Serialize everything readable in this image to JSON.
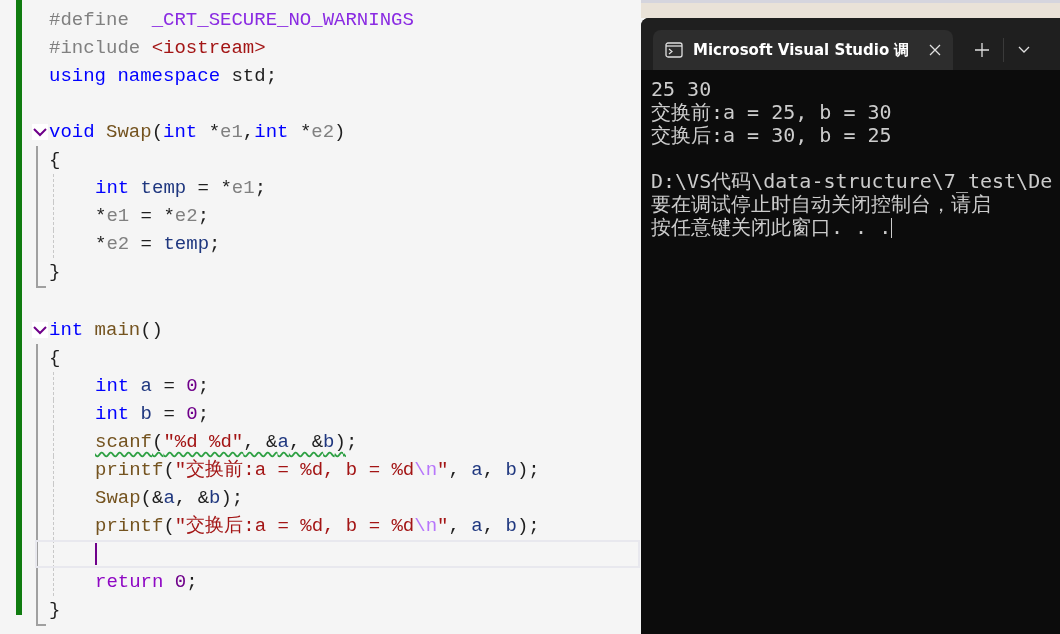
{
  "editor": {
    "blocks": [
      {
        "kind": "plain",
        "lines": [
          {
            "kind": "code",
            "tokens": [
              {
                "t": "#define  ",
                "kind": "pre"
              },
              {
                "t": "_CRT_SECURE_NO_WARNINGS",
                "kind": "macro"
              }
            ]
          },
          {
            "kind": "code",
            "tokens": [
              {
                "t": "#include ",
                "kind": "pre"
              },
              {
                "t": "<iostream>",
                "kind": "str"
              }
            ]
          },
          {
            "kind": "code",
            "tokens": [
              {
                "t": "using namespace",
                "kind": "kw"
              },
              {
                "t": " std;",
                "kind": "plain"
              }
            ]
          },
          {
            "kind": "blank",
            "current": false
          }
        ]
      },
      {
        "kind": "function",
        "expanded": true,
        "header": [
          {
            "t": "void ",
            "kind": "kw"
          },
          {
            "t": "Swap",
            "kind": "fn"
          },
          {
            "t": "(",
            "kind": "plain"
          },
          {
            "t": "int ",
            "kind": "kw"
          },
          {
            "t": "*",
            "kind": "plain"
          },
          {
            "t": "e1",
            "kind": "param"
          },
          {
            "t": ",",
            "kind": "plain"
          },
          {
            "t": "int ",
            "kind": "kw"
          },
          {
            "t": "*",
            "kind": "plain"
          },
          {
            "t": "e2",
            "kind": "param"
          },
          {
            "t": ")",
            "kind": "plain"
          }
        ],
        "lines": [
          {
            "kind": "code",
            "indented": false,
            "tokens": [
              {
                "t": "{",
                "kind": "plain"
              }
            ]
          },
          {
            "kind": "code",
            "indented": true,
            "tokens": [
              {
                "t": "int ",
                "kind": "kw"
              },
              {
                "t": "temp",
                "kind": "var"
              },
              {
                "t": " = *",
                "kind": "plain"
              },
              {
                "t": "e1",
                "kind": "param"
              },
              {
                "t": ";",
                "kind": "plain"
              }
            ]
          },
          {
            "kind": "code",
            "indented": true,
            "tokens": [
              {
                "t": "*",
                "kind": "plain"
              },
              {
                "t": "e1",
                "kind": "param"
              },
              {
                "t": " = *",
                "kind": "plain"
              },
              {
                "t": "e2",
                "kind": "param"
              },
              {
                "t": ";",
                "kind": "plain"
              }
            ]
          },
          {
            "kind": "code",
            "indented": true,
            "tokens": [
              {
                "t": "*",
                "kind": "plain"
              },
              {
                "t": "e2",
                "kind": "param"
              },
              {
                "t": " = ",
                "kind": "plain"
              },
              {
                "t": "temp",
                "kind": "var"
              },
              {
                "t": ";",
                "kind": "plain"
              }
            ]
          },
          {
            "kind": "code",
            "indented": false,
            "tokens": [
              {
                "t": "}",
                "kind": "plain"
              }
            ]
          }
        ]
      },
      {
        "kind": "plain",
        "lines": [
          {
            "kind": "blank",
            "current": false
          }
        ]
      },
      {
        "kind": "function",
        "expanded": true,
        "header": [
          {
            "t": "int ",
            "kind": "kw"
          },
          {
            "t": "main",
            "kind": "fn"
          },
          {
            "t": "()",
            "kind": "plain"
          }
        ],
        "lines": [
          {
            "kind": "code",
            "indented": false,
            "tokens": [
              {
                "t": "{",
                "kind": "plain"
              }
            ]
          },
          {
            "kind": "code",
            "indented": true,
            "tokens": [
              {
                "t": "int ",
                "kind": "kw"
              },
              {
                "t": "a",
                "kind": "var"
              },
              {
                "t": " = ",
                "kind": "plain"
              },
              {
                "t": "0",
                "kind": "num"
              },
              {
                "t": ";",
                "kind": "plain"
              }
            ]
          },
          {
            "kind": "code",
            "indented": true,
            "tokens": [
              {
                "t": "int ",
                "kind": "kw"
              },
              {
                "t": "b",
                "kind": "var"
              },
              {
                "t": " = ",
                "kind": "plain"
              },
              {
                "t": "0",
                "kind": "num"
              },
              {
                "t": ";",
                "kind": "plain"
              }
            ]
          },
          {
            "kind": "code",
            "indented": true,
            "tokens": [
              {
                "kind": "group",
                "squiggle": true,
                "tokens": [
                  {
                    "t": "scanf",
                    "kind": "fn"
                  },
                  {
                    "t": "(",
                    "kind": "plain"
                  },
                  {
                    "t": "\"%d %d\"",
                    "kind": "str"
                  },
                  {
                    "t": ", &",
                    "kind": "plain"
                  },
                  {
                    "t": "a",
                    "kind": "var"
                  },
                  {
                    "t": ", &",
                    "kind": "plain"
                  },
                  {
                    "t": "b",
                    "kind": "var"
                  },
                  {
                    "t": ")",
                    "kind": "plain"
                  }
                ]
              },
              {
                "t": ";",
                "kind": "plain"
              }
            ]
          },
          {
            "kind": "code",
            "indented": true,
            "tokens": [
              {
                "t": "printf",
                "kind": "fn"
              },
              {
                "t": "(",
                "kind": "plain"
              },
              {
                "t": "\"交换前:a = %d, b = %d",
                "kind": "str"
              },
              {
                "t": "\\n",
                "kind": "esc"
              },
              {
                "t": "\"",
                "kind": "str"
              },
              {
                "t": ", ",
                "kind": "plain"
              },
              {
                "t": "a",
                "kind": "var"
              },
              {
                "t": ", ",
                "kind": "plain"
              },
              {
                "t": "b",
                "kind": "var"
              },
              {
                "t": ");",
                "kind": "plain"
              }
            ]
          },
          {
            "kind": "code",
            "indented": true,
            "tokens": [
              {
                "t": "Swap",
                "kind": "fn"
              },
              {
                "t": "(&",
                "kind": "plain"
              },
              {
                "t": "a",
                "kind": "var"
              },
              {
                "t": ", &",
                "kind": "plain"
              },
              {
                "t": "b",
                "kind": "var"
              },
              {
                "t": ");",
                "kind": "plain"
              }
            ]
          },
          {
            "kind": "code",
            "indented": true,
            "tokens": [
              {
                "t": "printf",
                "kind": "fn"
              },
              {
                "t": "(",
                "kind": "plain"
              },
              {
                "t": "\"交换后:a = %d, b = %d",
                "kind": "str"
              },
              {
                "t": "\\n",
                "kind": "esc"
              },
              {
                "t": "\"",
                "kind": "str"
              },
              {
                "t": ", ",
                "kind": "plain"
              },
              {
                "t": "a",
                "kind": "var"
              },
              {
                "t": ", ",
                "kind": "plain"
              },
              {
                "t": "b",
                "kind": "var"
              },
              {
                "t": ");",
                "kind": "plain"
              }
            ]
          },
          {
            "kind": "blank",
            "current": true
          },
          {
            "kind": "code",
            "indented": true,
            "tokens": [
              {
                "t": "return ",
                "kind": "ctl"
              },
              {
                "t": "0",
                "kind": "num"
              },
              {
                "t": ";",
                "kind": "plain"
              }
            ]
          },
          {
            "kind": "code",
            "indented": false,
            "tokens": [
              {
                "t": "}",
                "kind": "plain"
              }
            ]
          }
        ]
      }
    ]
  },
  "terminal": {
    "tab": {
      "title": "Microsoft Visual Studio 调",
      "selected": true
    },
    "lines": [
      {
        "kind": "text",
        "text": "25 30"
      },
      {
        "kind": "text",
        "text": "交换前:a = 25, b = 30"
      },
      {
        "kind": "text",
        "text": "交换后:a = 30, b = 25"
      },
      {
        "kind": "blank"
      },
      {
        "kind": "text",
        "text": "D:\\VS代码\\data-structure\\7_test\\De"
      },
      {
        "kind": "text",
        "text": "要在调试停止时自动关闭控制台，请启"
      },
      {
        "kind": "text",
        "text": "按任意键关闭此窗口. . ."
      }
    ]
  }
}
